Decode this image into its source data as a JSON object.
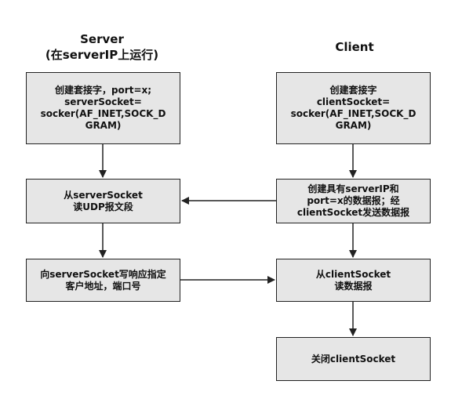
{
  "titles": {
    "server": "Server",
    "server_sub": "(在serverIP上运行)",
    "client": "Client"
  },
  "server_boxes": [
    "创建套接字，port=x;\nserverSocket=\nsocker(AF_INET,SOCK_D\nGRAM)",
    "从serverSocket\n读UDP报文段",
    "向serverSocket写响应指定\n客户地址，端口号"
  ],
  "client_boxes": [
    "创建套接字\nclientSocket=\nsocker(AF_INET,SOCK_D\nGRAM)",
    "创建具有serverIP和\nport=x的数据报；经\nclientSocket发送数据报",
    "从clientSocket\n读数据报",
    "关闭clientSocket"
  ]
}
